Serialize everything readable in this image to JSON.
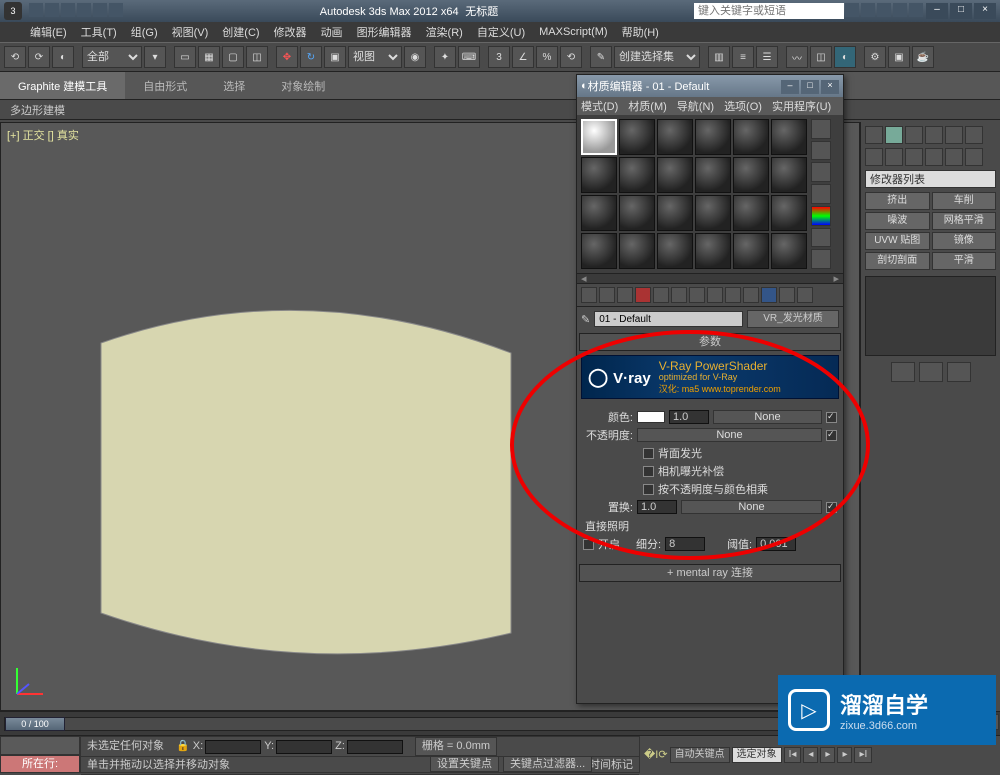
{
  "titlebar": {
    "app": "Autodesk 3ds Max 2012 x64",
    "doc": "无标题",
    "search_placeholder": "键入关键字或短语"
  },
  "menubar": [
    "编辑(E)",
    "工具(T)",
    "组(G)",
    "视图(V)",
    "创建(C)",
    "修改器",
    "动画",
    "图形编辑器",
    "渲染(R)",
    "自定义(U)",
    "MAXScript(M)",
    "帮助(H)"
  ],
  "toolbar": {
    "scope": "全部",
    "viewlabel": "视图",
    "createset": "创建选择集"
  },
  "ribbon": {
    "tabs": [
      "Graphite 建模工具",
      "自由形式",
      "选择",
      "对象绘制"
    ]
  },
  "subribbon": "多边形建模",
  "viewport": {
    "label": "[+] 正交 [] 真实"
  },
  "sidepanel": {
    "dropdown": "修改器列表",
    "buttons": [
      "挤出",
      "车削",
      "噪波",
      "网格平滑",
      "UVW 贴图",
      "镜像",
      "剖切剖面",
      "平滑"
    ]
  },
  "material_editor": {
    "title": "材质编辑器 - 01 - Default",
    "menu": [
      "模式(D)",
      "材质(M)",
      "导航(N)",
      "选项(O)",
      "实用程序(U)"
    ],
    "name": "01 - Default",
    "type": "VR_发光材质",
    "roll_params": "参数",
    "vray": {
      "brand": "V·ray",
      "head": "V-Ray PowerShader",
      "sub": "optimized for V-Ray",
      "credit": "汉化: ma5 www.toprender.com"
    },
    "params": {
      "color_lbl": "颜色:",
      "color_spin": "1.0",
      "none": "None",
      "opacity_lbl": "不透明度:",
      "chk1": "背面发光",
      "chk2": "相机曝光补偿",
      "chk3": "按不透明度与颜色相乘",
      "replace_lbl": "置换:",
      "replace_spin": "1.0",
      "direct_lbl": "直接照明",
      "on_lbl": "开启",
      "subdiv_lbl": "细分:",
      "subdiv_val": "8",
      "thresh_lbl": "阈值:",
      "thresh_val": "0.001"
    },
    "roll_mr": "mental ray 连接"
  },
  "timeline": {
    "range": "0 / 100"
  },
  "status": {
    "nowbtn": "所在行:",
    "line1": "未选定任何对象",
    "line2": "单击并拖动以选择并移动对象",
    "addmarker": "添加时间标记",
    "grid": "栅格 = 0.0mm",
    "autokey": "自动关键点",
    "selset": "选定对象",
    "setkey": "设置关键点",
    "keyfilter": "关键点过滤器..."
  },
  "watermark": {
    "big": "溜溜自学",
    "small": "zixue.3d66.com"
  }
}
